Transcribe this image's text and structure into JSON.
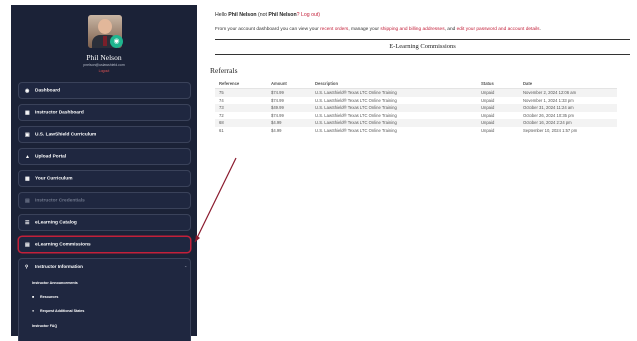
{
  "profile": {
    "name": "Phil Nelson",
    "email": "pnelson@uslawshield.com",
    "logout": "Logout"
  },
  "nav": {
    "dashboard": "Dashboard",
    "instructor_dashboard": "Instructor Dashboard",
    "curriculum": "U.S. LawShield Curriculum",
    "upload_portal": "Upload Portal",
    "your_curriculum": "Your Curriculum",
    "credentials": "Instructor Credentials",
    "catalog": "eLearning Catalog",
    "commissions": "eLearning Commissions",
    "instructor_info": "Instructor Information",
    "announcements": "Instructor Announcements",
    "resources": "Resources",
    "request_states": "Request Additional States",
    "faq": "Instructor FAQ"
  },
  "greeting": {
    "hello": "Hello",
    "name": "Phil Nelson",
    "not_open": "(not",
    "not_name": "Phil Nelson",
    "log_out": "? Log out)",
    "intro_1": "From your account dashboard you can view your",
    "recent_orders": "recent orders",
    "intro_2": ", manage your",
    "addresses": "shipping and billing addresses",
    "intro_3": ", and",
    "edit_account": "edit your password and account details",
    "intro_end": "."
  },
  "section_title": "E-Learning Commissions",
  "referrals": {
    "title": "Referrals",
    "headers": [
      "Reference",
      "Amount",
      "Description",
      "Status",
      "Date"
    ],
    "rows": [
      [
        "75",
        "$74.99",
        "U.S. LawShield® Texas LTC Online Training",
        "Unpaid",
        "November 2, 2024 12:06 am"
      ],
      [
        "74",
        "$74.99",
        "U.S. LawShield® Texas LTC Online Training",
        "Unpaid",
        "November 1, 2024 1:33 pm"
      ],
      [
        "73",
        "$49.99",
        "U.S. LawShield® Texas LTC Online Training",
        "Unpaid",
        "October 31, 2024 11:24 am"
      ],
      [
        "72",
        "$74.99",
        "U.S. LawShield® Texas LTC Online Training",
        "Unpaid",
        "October 26, 2024 10:35 pm"
      ],
      [
        "68",
        "$4.99",
        "U.S. LawShield® Texas LTC Online Training",
        "Unpaid",
        "October 16, 2024 2:24 pm"
      ],
      [
        "61",
        "$4.99",
        "U.S. LawShield® Texas LTC Online Training",
        "Unpaid",
        "September 10, 2024 1:57 pm"
      ]
    ]
  },
  "colors": {
    "sidebar_bg": "#1b2237",
    "accent_red": "#c3203a",
    "annotation_arrow": "#8b1a2e"
  }
}
